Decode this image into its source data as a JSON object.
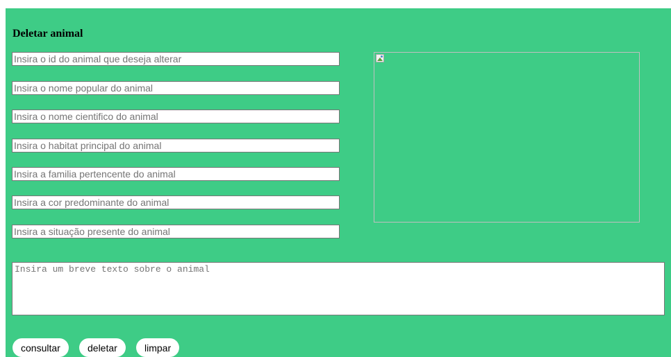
{
  "form": {
    "title": "Deletar animal",
    "fields": [
      {
        "name": "id-field",
        "placeholder": "Insira o id do animal que deseja alterar"
      },
      {
        "name": "popular-name-field",
        "placeholder": "Insira o nome popular do animal"
      },
      {
        "name": "scientific-name-field",
        "placeholder": "Insira o nome cientifico do animal"
      },
      {
        "name": "habitat-field",
        "placeholder": "Insira o habitat principal do animal"
      },
      {
        "name": "family-field",
        "placeholder": "Insira a familia pertencente do animal"
      },
      {
        "name": "color-field",
        "placeholder": "Insira a cor predominante do animal"
      },
      {
        "name": "situation-field",
        "placeholder": "Insira a situação presente do animal"
      }
    ],
    "description_placeholder": "Insira um breve texto sobre o animal",
    "image_icon": "broken-image-icon"
  },
  "buttons": {
    "consultar": "consultar",
    "deletar": "deletar",
    "limpar": "limpar"
  },
  "colors": {
    "panel_background": "#3ecc86"
  }
}
